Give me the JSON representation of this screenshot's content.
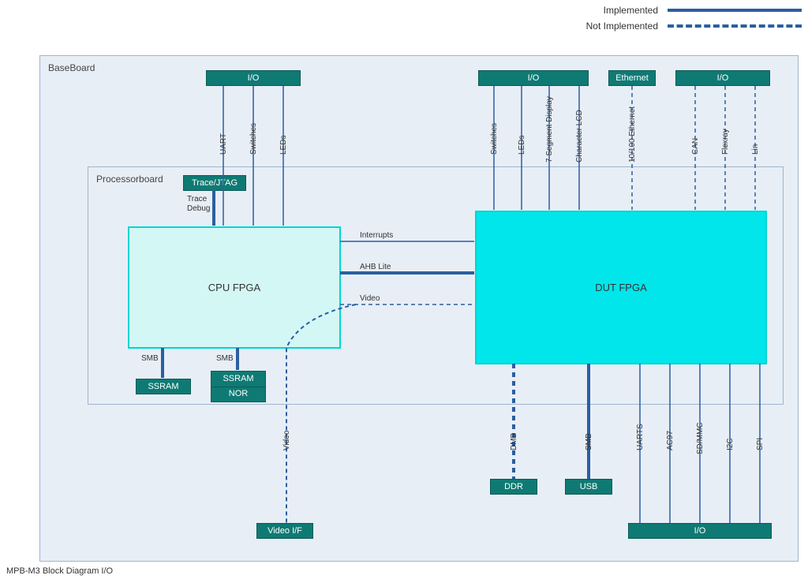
{
  "legend": {
    "implemented": "Implemented",
    "not_implemented": "Not Implemented"
  },
  "caption": "MPB-M3 Block Diagram I/O",
  "baseboard": {
    "title": "BaseBoard"
  },
  "processorboard": {
    "title": "Processorboard"
  },
  "blocks": {
    "io_cpu": "I/O",
    "io_dut_top": "I/O",
    "ethernet": "Ethernet",
    "io_right_top": "I/O",
    "trace_jtag": "Trace/JTAG",
    "cpu_fpga": "CPU FPGA",
    "dut_fpga": "DUT FPGA",
    "ssram1": "SSRAM",
    "ssram2": "SSRAM",
    "nor": "NOR",
    "video_if": "Video I/F",
    "ddr": "DDR",
    "usb": "USB",
    "io_bottom": "I/O"
  },
  "signals": {
    "uart": "UART",
    "switches": "Switches",
    "leds": "LEDs",
    "switches2": "Switches",
    "leds2": "LEDs",
    "seg7": "7 Segment Display",
    "char_lcd": "Character LCD",
    "eth10100": "10/100 Ethernet",
    "can": "CAN",
    "flexray": "Flexray",
    "lin": "Lin",
    "trace_debug_1": "Trace",
    "trace_debug_2": "Debug",
    "smb1": "SMB",
    "smb2": "SMB",
    "interrupts": "Interrupts",
    "ahb_lite": "AHB Lite",
    "video": "Video",
    "video_down": "Video",
    "dmb": "DMB",
    "smb3": "SMB",
    "uarts": "UARTS",
    "ac97": "AC97",
    "sdmmc": "SD/MMC",
    "i2c": "I2C",
    "spi": "SPI"
  },
  "chart_data": {
    "type": "block-diagram",
    "title": "MPB-M3 Block Diagram I/O",
    "containers": [
      {
        "id": "BaseBoard"
      },
      {
        "id": "Processorboard",
        "parent": "BaseBoard"
      }
    ],
    "nodes": [
      {
        "id": "IO_CPU",
        "label": "I/O",
        "parent": "BaseBoard"
      },
      {
        "id": "IO_DUT",
        "label": "I/O",
        "parent": "BaseBoard"
      },
      {
        "id": "ETH",
        "label": "Ethernet",
        "parent": "BaseBoard"
      },
      {
        "id": "IO_R",
        "label": "I/O",
        "parent": "BaseBoard"
      },
      {
        "id": "TRACE",
        "label": "Trace/JTAG",
        "parent": "Processorboard"
      },
      {
        "id": "CPU",
        "label": "CPU FPGA",
        "parent": "Processorboard"
      },
      {
        "id": "DUT",
        "label": "DUT FPGA",
        "parent": "Processorboard"
      },
      {
        "id": "SSRAM1",
        "label": "SSRAM",
        "parent": "Processorboard"
      },
      {
        "id": "SSRAM2",
        "label": "SSRAM",
        "parent": "Processorboard"
      },
      {
        "id": "NOR",
        "label": "NOR",
        "parent": "Processorboard"
      },
      {
        "id": "VIDEOIF",
        "label": "Video I/F",
        "parent": "BaseBoard"
      },
      {
        "id": "DDR",
        "label": "DDR",
        "parent": "BaseBoard"
      },
      {
        "id": "USB",
        "label": "USB",
        "parent": "BaseBoard"
      },
      {
        "id": "IO_B",
        "label": "I/O",
        "parent": "BaseBoard"
      }
    ],
    "edges": [
      {
        "from": "IO_CPU",
        "to": "CPU",
        "label": "UART",
        "style": "solid"
      },
      {
        "from": "IO_CPU",
        "to": "CPU",
        "label": "Switches",
        "style": "solid"
      },
      {
        "from": "IO_CPU",
        "to": "CPU",
        "label": "LEDs",
        "style": "solid"
      },
      {
        "from": "IO_DUT",
        "to": "DUT",
        "label": "Switches",
        "style": "solid"
      },
      {
        "from": "IO_DUT",
        "to": "DUT",
        "label": "LEDs",
        "style": "solid"
      },
      {
        "from": "IO_DUT",
        "to": "DUT",
        "label": "7 Segment Display",
        "style": "solid"
      },
      {
        "from": "IO_DUT",
        "to": "DUT",
        "label": "Character LCD",
        "style": "solid"
      },
      {
        "from": "ETH",
        "to": "DUT",
        "label": "10/100 Ethernet",
        "style": "dashed"
      },
      {
        "from": "IO_R",
        "to": "DUT",
        "label": "CAN",
        "style": "dashed"
      },
      {
        "from": "IO_R",
        "to": "DUT",
        "label": "Flexray",
        "style": "dashed"
      },
      {
        "from": "IO_R",
        "to": "DUT",
        "label": "Lin",
        "style": "dashed"
      },
      {
        "from": "TRACE",
        "to": "CPU",
        "label": "Trace Debug",
        "style": "solid",
        "weight": "thick"
      },
      {
        "from": "CPU",
        "to": "SSRAM1",
        "label": "SMB",
        "style": "solid",
        "weight": "thick"
      },
      {
        "from": "CPU",
        "to": "SSRAM2",
        "label": "SMB",
        "style": "solid",
        "weight": "thick"
      },
      {
        "from": "CPU",
        "to": "DUT",
        "label": "Interrupts",
        "style": "solid"
      },
      {
        "from": "CPU",
        "to": "DUT",
        "label": "AHB Lite",
        "style": "solid",
        "weight": "thick"
      },
      {
        "from": "CPU",
        "to": "DUT",
        "label": "Video",
        "style": "dashed"
      },
      {
        "from": "CPU",
        "to": "VIDEOIF",
        "label": "Video",
        "style": "dashed"
      },
      {
        "from": "DUT",
        "to": "DDR",
        "label": "DMB",
        "style": "dashed",
        "weight": "thick"
      },
      {
        "from": "DUT",
        "to": "USB",
        "label": "SMB",
        "style": "solid",
        "weight": "thick"
      },
      {
        "from": "DUT",
        "to": "IO_B",
        "label": "UARTS",
        "style": "solid"
      },
      {
        "from": "DUT",
        "to": "IO_B",
        "label": "AC97",
        "style": "solid"
      },
      {
        "from": "DUT",
        "to": "IO_B",
        "label": "SD/MMC",
        "style": "solid"
      },
      {
        "from": "DUT",
        "to": "IO_B",
        "label": "I2C",
        "style": "solid"
      },
      {
        "from": "DUT",
        "to": "IO_B",
        "label": "SPI",
        "style": "solid"
      }
    ]
  }
}
